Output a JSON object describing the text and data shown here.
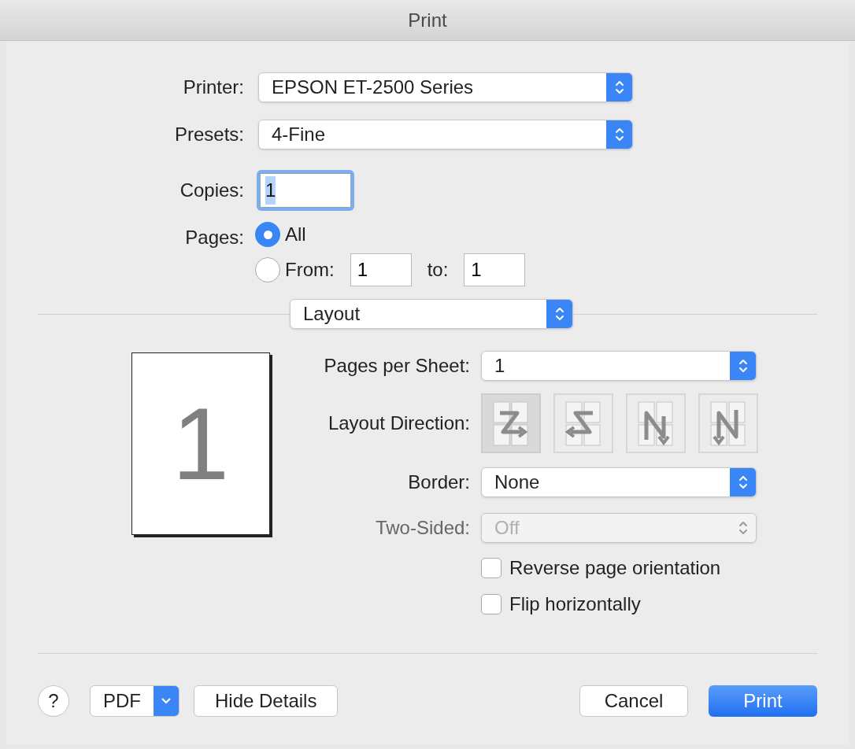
{
  "window": {
    "title": "Print"
  },
  "printer": {
    "label": "Printer:",
    "value": "EPSON ET-2500 Series"
  },
  "presets": {
    "label": "Presets:",
    "value": "4-Fine"
  },
  "copies": {
    "label": "Copies:",
    "value": "1"
  },
  "pages": {
    "label": "Pages:",
    "options": [
      {
        "label": "All",
        "selected": true
      },
      {
        "label": "From:",
        "selected": false
      }
    ],
    "from": "1",
    "to_label": "to:",
    "to": "1"
  },
  "section_menu": {
    "value": "Layout"
  },
  "preview": {
    "page_number": "1"
  },
  "layout": {
    "pages_per_sheet": {
      "label": "Pages per Sheet:",
      "value": "1",
      "disabled": false
    },
    "direction_label": "Layout Direction:",
    "directions": [
      {
        "kind": "z",
        "selected": true
      },
      {
        "kind": "s",
        "selected": false
      },
      {
        "kind": "n-reverse",
        "selected": false
      },
      {
        "kind": "n",
        "selected": false
      }
    ],
    "border": {
      "label": "Border:",
      "value": "None",
      "disabled": false
    },
    "two_sided": {
      "label": "Two-Sided:",
      "value": "Off",
      "disabled": true
    },
    "checkboxes": [
      {
        "label": "Reverse page orientation",
        "checked": false
      },
      {
        "label": "Flip horizontally",
        "checked": false
      }
    ]
  },
  "footer": {
    "help": "?",
    "pdf": "PDF",
    "hide_details": "Hide Details",
    "cancel": "Cancel",
    "print": "Print"
  }
}
